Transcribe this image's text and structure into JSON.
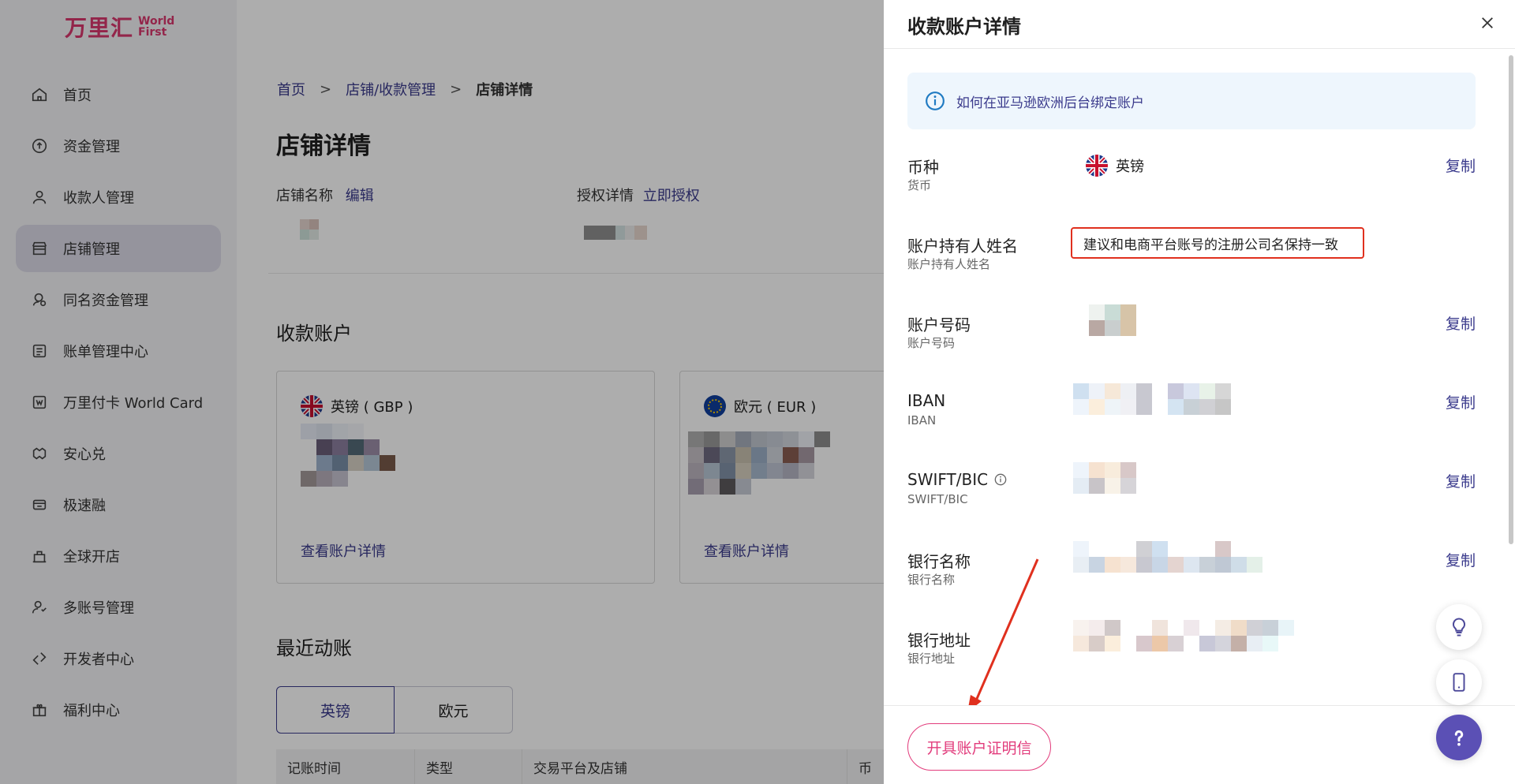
{
  "sidebar": {
    "logo_cn": "万里汇",
    "logo_en_line1": "World",
    "logo_en_line2": "First",
    "items": [
      {
        "label": "首页",
        "icon": "home-icon"
      },
      {
        "label": "资金管理",
        "icon": "fund-icon"
      },
      {
        "label": "收款人管理",
        "icon": "user-icon"
      },
      {
        "label": "店铺管理",
        "icon": "store-icon",
        "active": true
      },
      {
        "label": "同名资金管理",
        "icon": "search-user-icon"
      },
      {
        "label": "账单管理中心",
        "icon": "bill-icon"
      },
      {
        "label": "万里付卡 World Card",
        "icon": "card-icon"
      },
      {
        "label": "安心兑",
        "icon": "exchange-icon"
      },
      {
        "label": "极速融",
        "icon": "finance-icon"
      },
      {
        "label": "全球开店",
        "icon": "shop-icon"
      },
      {
        "label": "多账号管理",
        "icon": "multi-account-icon"
      },
      {
        "label": "开发者中心",
        "icon": "developer-icon"
      },
      {
        "label": "福利中心",
        "icon": "gift-icon"
      }
    ]
  },
  "main": {
    "breadcrumb": [
      "首页",
      "店铺/收款管理",
      "店铺详情"
    ],
    "page_title": "店铺详情",
    "store_name_label": "店铺名称",
    "edit_link": "编辑",
    "auth_label": "授权详情",
    "auth_link": "立即授权",
    "receive_section": "收款账户",
    "cards": [
      {
        "currency": "英镑 ( GBP )",
        "link": "查看账户详情"
      },
      {
        "currency": "欧元 ( EUR )",
        "link": "查看账户详情"
      }
    ],
    "recent_section": "最近动账",
    "tabs": [
      "英镑",
      "欧元"
    ],
    "table_headers": [
      "记账时间",
      "类型",
      "交易平台及店铺",
      "币"
    ]
  },
  "drawer": {
    "title": "收款账户详情",
    "info_banner": "如何在亚马逊欧洲后台绑定账户",
    "copy_label": "复制",
    "rows": [
      {
        "label": "币种",
        "sub": "货币",
        "value": "英镑",
        "copy": true
      },
      {
        "label": "账户持有人姓名",
        "sub": "账户持有人姓名",
        "copy": false
      },
      {
        "label": "账户号码",
        "sub": "账户号码",
        "copy": true
      },
      {
        "label": "IBAN",
        "sub": "IBAN",
        "copy": true
      },
      {
        "label": "SWIFT/BIC",
        "sub": "SWIFT/BIC",
        "copy": true
      },
      {
        "label": "银行名称",
        "sub": "银行名称",
        "copy": true
      },
      {
        "label": "银行地址",
        "sub": "银行地址",
        "copy": false
      }
    ],
    "holder_hint": "建议和电商平台账号的注册公司名保持一致",
    "cert_button": "开具账户证明信"
  },
  "colors": {
    "accent": "#3a3a8c",
    "brand": "#d9376e",
    "highlight": "#e0301e",
    "help_fab": "#5b50b5"
  }
}
